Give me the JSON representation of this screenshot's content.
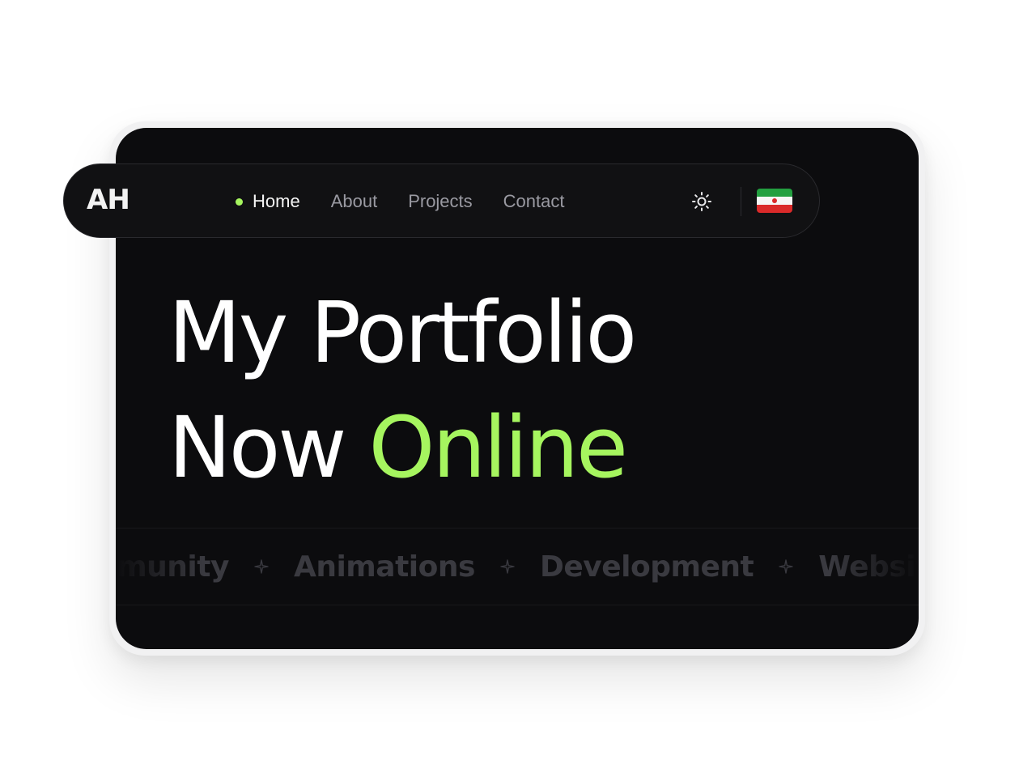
{
  "nav": {
    "logo": "AH",
    "links": [
      {
        "label": "Home",
        "active": true
      },
      {
        "label": "About",
        "active": false
      },
      {
        "label": "Projects",
        "active": false
      },
      {
        "label": "Contact",
        "active": false
      }
    ],
    "theme_icon": "sun-icon",
    "language_icon": "iran-flag-icon"
  },
  "hero": {
    "line1": "My Portfolio",
    "line2_prefix": "Now",
    "line2_accent": "Online"
  },
  "marquee": {
    "items": [
      "Community",
      "Animations",
      "Development",
      "Websites"
    ],
    "separator_icon": "sparkle-icon"
  },
  "colors": {
    "background": "#0c0c0e",
    "accent": "#a6f55f",
    "text": "#ffffff",
    "muted": "#9a9aa2"
  }
}
